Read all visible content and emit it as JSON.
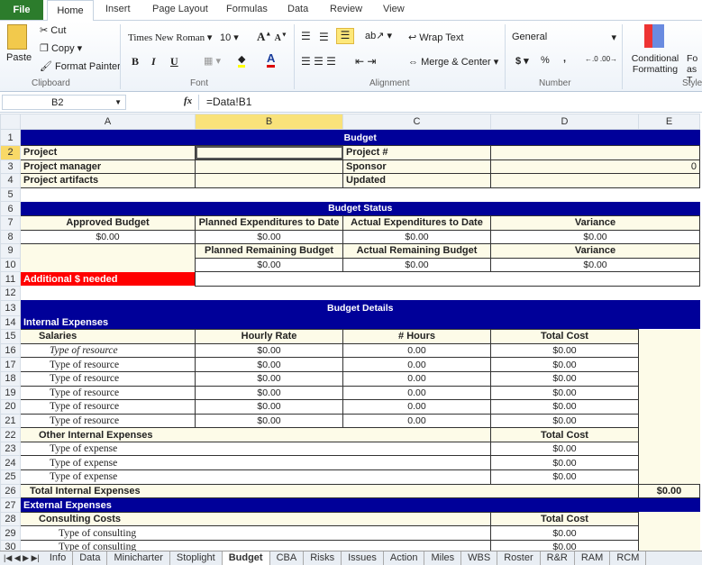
{
  "ribbon": {
    "tabs": [
      "File",
      "Home",
      "Insert",
      "Page Layout",
      "Formulas",
      "Data",
      "Review",
      "View"
    ],
    "clipboard": {
      "paste": "Paste",
      "cut": "Cut",
      "copy": "Copy",
      "format_painter": "Format Painter",
      "group": "Clipboard"
    },
    "font": {
      "name": "Times New Roman",
      "size": "10",
      "bold": "B",
      "italic": "I",
      "underline": "U",
      "group": "Font"
    },
    "alignment": {
      "wrap_text": "Wrap Text",
      "merge_center": "Merge & Center",
      "group": "Alignment"
    },
    "number": {
      "format": "General",
      "currency": "$",
      "percent": "%",
      "comma": ",",
      "group": "Number"
    },
    "styles": {
      "conditional_formatting": "Conditional Formatting",
      "format_as_table": "Fo as T",
      "group": "Style"
    }
  },
  "formula_bar": {
    "name_box": "B2",
    "fx": "fx",
    "formula": "=Data!B1"
  },
  "columns": [
    "A",
    "B",
    "C",
    "D",
    "E"
  ],
  "selected_column": "B",
  "selected_row": "2",
  "colors": {
    "band": "#000099",
    "cream": "#fdfbe8",
    "alert": "#ff0000"
  },
  "rows": [
    {
      "n": "1",
      "cells": [
        "Budget"
      ]
    },
    {
      "n": "2",
      "cells": [
        "Project",
        "",
        "Project #",
        ""
      ]
    },
    {
      "n": "3",
      "cells": [
        "Project manager",
        "",
        "Sponsor",
        "0"
      ]
    },
    {
      "n": "4",
      "cells": [
        "Project artifacts",
        "",
        "Updated",
        ""
      ]
    },
    {
      "n": "5",
      "cells": [
        ""
      ]
    },
    {
      "n": "6",
      "cells": [
        "Budget Status"
      ]
    },
    {
      "n": "7",
      "cells": [
        "Approved Budget",
        "Planned Expenditures to Date",
        "Actual Expenditures to Date",
        "Variance"
      ]
    },
    {
      "n": "8",
      "cells": [
        "$0.00",
        "$0.00",
        "$0.00",
        "$0.00"
      ]
    },
    {
      "n": "9",
      "cells": [
        "",
        "Planned Remaining Budget",
        "Actual Remaining Budget",
        "Variance"
      ]
    },
    {
      "n": "10",
      "cells": [
        "",
        "$0.00",
        "$0.00",
        "$0.00"
      ]
    },
    {
      "n": "11",
      "cells": [
        "Additional $ needed",
        ""
      ]
    },
    {
      "n": "12",
      "cells": [
        ""
      ]
    },
    {
      "n": "13",
      "cells": [
        "Budget Details"
      ]
    },
    {
      "n": "14",
      "cells": [
        "Internal Expenses"
      ]
    },
    {
      "n": "15",
      "cells": [
        "Salaries",
        "Hourly Rate",
        "# Hours",
        "Total Cost",
        ""
      ]
    },
    {
      "n": "16",
      "cells": [
        "Type of resource",
        "$0.00",
        "0.00",
        "$0.00",
        ""
      ]
    },
    {
      "n": "17",
      "cells": [
        "Type of resource",
        "$0.00",
        "0.00",
        "$0.00",
        ""
      ]
    },
    {
      "n": "18",
      "cells": [
        "Type of resource",
        "$0.00",
        "0.00",
        "$0.00",
        ""
      ]
    },
    {
      "n": "19",
      "cells": [
        "Type of resource",
        "$0.00",
        "0.00",
        "$0.00",
        ""
      ]
    },
    {
      "n": "20",
      "cells": [
        "Type of resource",
        "$0.00",
        "0.00",
        "$0.00",
        ""
      ]
    },
    {
      "n": "21",
      "cells": [
        "Type of resource",
        "$0.00",
        "0.00",
        "$0.00",
        ""
      ]
    },
    {
      "n": "22",
      "cells": [
        "Other Internal Expenses",
        "Total Cost",
        ""
      ]
    },
    {
      "n": "23",
      "cells": [
        "Type of expense",
        "$0.00",
        ""
      ]
    },
    {
      "n": "24",
      "cells": [
        "Type of expense",
        "$0.00",
        ""
      ]
    },
    {
      "n": "25",
      "cells": [
        "Type of expense",
        "$0.00",
        ""
      ]
    },
    {
      "n": "26",
      "cells": [
        "Total Internal Expenses",
        "$0.00"
      ]
    },
    {
      "n": "27",
      "cells": [
        "External Expenses"
      ]
    },
    {
      "n": "28",
      "cells": [
        "Consulting Costs",
        "Total Cost",
        ""
      ]
    },
    {
      "n": "29",
      "cells": [
        "Type of consulting",
        "$0.00",
        ""
      ]
    },
    {
      "n": "30",
      "cells": [
        "Type of consulting",
        "$0.00",
        ""
      ]
    }
  ],
  "sheet_tabs": [
    "Info",
    "Data",
    "Minicharter",
    "Stoplight",
    "Budget",
    "CBA",
    "Risks",
    "Issues",
    "Action",
    "Miles",
    "WBS",
    "Roster",
    "R&R",
    "RAM",
    "RCM"
  ],
  "active_sheet": "Budget"
}
